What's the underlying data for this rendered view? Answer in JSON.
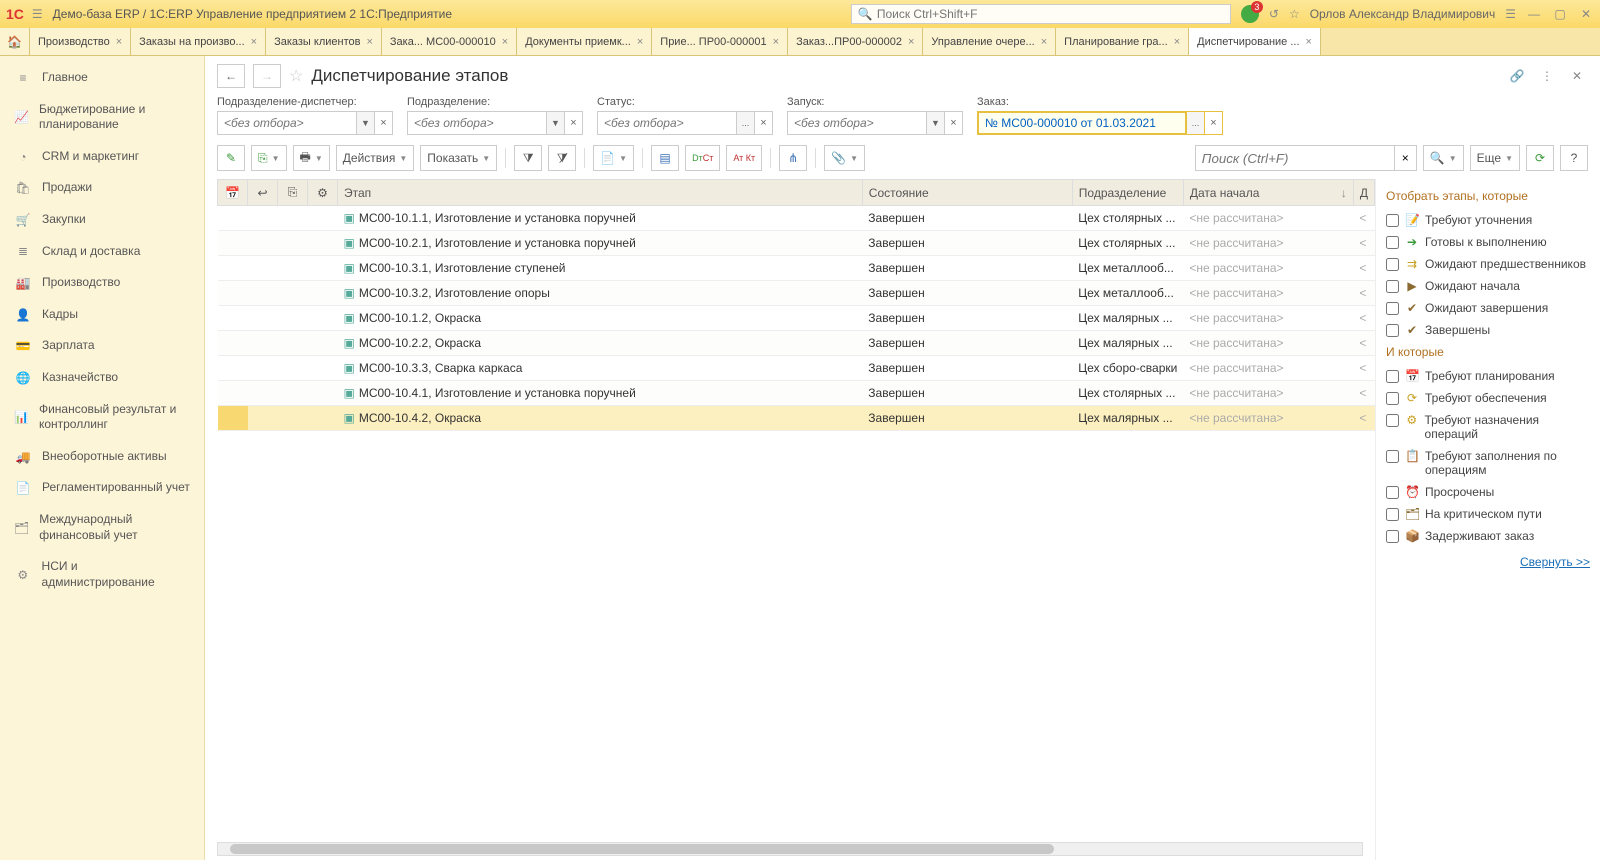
{
  "titlebar": {
    "app_title": "Демо-база ERP / 1C:ERP Управление предприятием 2 1С:Предприятие",
    "search_placeholder": "Поиск Ctrl+Shift+F",
    "notif_count": "3",
    "user_name": "Орлов Александр Владимирович"
  },
  "tabs": [
    {
      "label": "Производство"
    },
    {
      "label": "Заказы на произво..."
    },
    {
      "label": "Заказы клиентов"
    },
    {
      "label": "Зака... МС00-000010"
    },
    {
      "label": "Документы приемк..."
    },
    {
      "label": "Прие... ПР00-000001"
    },
    {
      "label": "Заказ...ПР00-000002"
    },
    {
      "label": "Управление очере..."
    },
    {
      "label": "Планирование гра..."
    },
    {
      "label": "Диспетчирование ...",
      "active": true
    }
  ],
  "sidebar": [
    {
      "icon": "≡",
      "label": "Главное"
    },
    {
      "icon": "📈",
      "label": "Бюджетирование и планирование"
    },
    {
      "icon": "◔",
      "label": "CRM и маркетинг"
    },
    {
      "icon": "🛍",
      "label": "Продажи"
    },
    {
      "icon": "🛒",
      "label": "Закупки"
    },
    {
      "icon": "≣",
      "label": "Склад и доставка"
    },
    {
      "icon": "🏭",
      "label": "Производство"
    },
    {
      "icon": "👤",
      "label": "Кадры"
    },
    {
      "icon": "💳",
      "label": "Зарплата"
    },
    {
      "icon": "🌐",
      "label": "Казначейство"
    },
    {
      "icon": "📊",
      "label": "Финансовый результат и контроллинг"
    },
    {
      "icon": "🚚",
      "label": "Внеоборотные активы"
    },
    {
      "icon": "📄",
      "label": "Регламентированный учет"
    },
    {
      "icon": "🗂",
      "label": "Международный финансовый учет"
    },
    {
      "icon": "⚙",
      "label": "НСИ и администрирование"
    }
  ],
  "page": {
    "title": "Диспетчирование этапов"
  },
  "filters": {
    "f1_label": "Подразделение-диспетчер:",
    "f2_label": "Подразделение:",
    "f3_label": "Статус:",
    "f4_label": "Запуск:",
    "f5_label": "Заказ:",
    "empty_placeholder": "<без отбора>",
    "order_value": "№ МС00-000010 от 01.03.2021"
  },
  "toolbar": {
    "actions": "Действия",
    "show": "Показать",
    "more": "Еще",
    "search_placeholder": "Поиск (Ctrl+F)"
  },
  "table": {
    "headers": {
      "stage": "Этап",
      "state": "Состояние",
      "dept": "Подразделение",
      "start": "Дата начала",
      "end": "Д"
    },
    "not_calc": "<не рассчитана>",
    "rows": [
      {
        "stage": "МС00-10.1.1, Изготовление и установка поручней",
        "state": "Завершен",
        "dept": "Цех столярных ..."
      },
      {
        "stage": "МС00-10.2.1, Изготовление и установка поручней",
        "state": "Завершен",
        "dept": "Цех столярных ..."
      },
      {
        "stage": "МС00-10.3.1, Изготовление ступеней",
        "state": "Завершен",
        "dept": "Цех металлооб..."
      },
      {
        "stage": "МС00-10.3.2, Изготовление опоры",
        "state": "Завершен",
        "dept": "Цех металлооб..."
      },
      {
        "stage": "МС00-10.1.2, Окраска",
        "state": "Завершен",
        "dept": "Цех малярных ..."
      },
      {
        "stage": "МС00-10.2.2, Окраска",
        "state": "Завершен",
        "dept": "Цех малярных ..."
      },
      {
        "stage": "МС00-10.3.3, Сварка каркаса",
        "state": "Завершен",
        "dept": "Цех сборо-сварки"
      },
      {
        "stage": "МС00-10.4.1, Изготовление и установка поручней",
        "state": "Завершен",
        "dept": "Цех столярных ..."
      },
      {
        "stage": "МС00-10.4.2, Окраска",
        "state": "Завершен",
        "dept": "Цех малярных ...",
        "sel": true
      }
    ]
  },
  "side_panel": {
    "heading1": "Отобрать этапы, которые",
    "heading2": "И которые",
    "group1": [
      {
        "icon": "📝",
        "cls": "icon-yellow",
        "label": "Требуют уточнения"
      },
      {
        "icon": "➔",
        "cls": "icon-green",
        "label": "Готовы к выполнению"
      },
      {
        "icon": "⇉",
        "cls": "icon-yellow",
        "label": "Ожидают предшественников"
      },
      {
        "icon": "▶",
        "cls": "icon-brown",
        "label": "Ожидают начала"
      },
      {
        "icon": "✔",
        "cls": "icon-brown",
        "label": "Ожидают завершения"
      },
      {
        "icon": "✔",
        "cls": "icon-brown",
        "label": "Завершены"
      }
    ],
    "group2": [
      {
        "icon": "📅",
        "cls": "icon-yellow",
        "label": "Требуют планирования"
      },
      {
        "icon": "⟳",
        "cls": "icon-yellow",
        "label": "Требуют обеспечения"
      },
      {
        "icon": "⚙",
        "cls": "icon-yellow",
        "label": "Требуют назначения операций"
      },
      {
        "icon": "📋",
        "cls": "icon-yellow",
        "label": "Требуют заполнения по операциям"
      },
      {
        "icon": "⏰",
        "cls": "icon-red",
        "label": "Просрочены"
      },
      {
        "icon": "🗂",
        "cls": "icon-brown",
        "label": "На критическом пути"
      },
      {
        "icon": "📦",
        "cls": "icon-red",
        "label": "Задерживают заказ"
      }
    ],
    "collapse": "Свернуть >>"
  }
}
